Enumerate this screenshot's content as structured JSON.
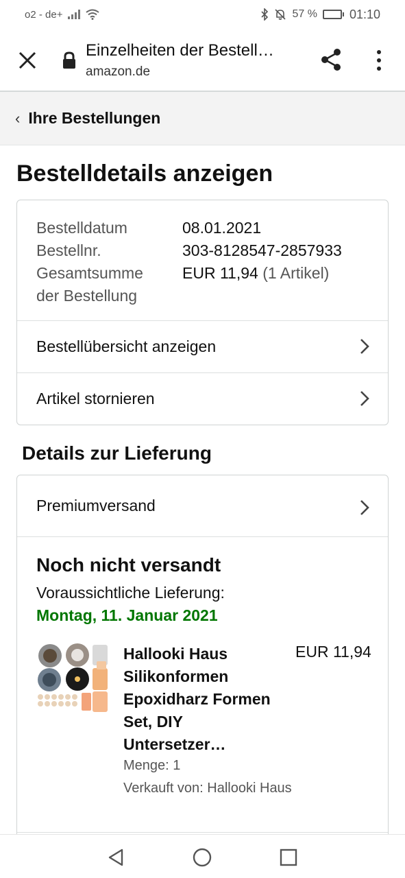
{
  "status_bar": {
    "carrier": "o2 - de+",
    "battery_text": "57 %",
    "battery_level": 0.57,
    "time": "01:10",
    "icons": [
      "signal-icon",
      "wifi-icon",
      "bluetooth-icon",
      "mute-icon",
      "battery-icon"
    ]
  },
  "browser": {
    "title": "Einzelheiten der Bestell…",
    "url": "amazon.de",
    "icons": [
      "close-icon",
      "lock-icon",
      "share-icon",
      "more-vert-icon"
    ]
  },
  "breadcrumb": {
    "label": "Ihre Bestellungen"
  },
  "page": {
    "title": "Bestelldetails anzeigen"
  },
  "order": {
    "date_label": "Bestelldatum",
    "date_value": "08.01.2021",
    "number_label": "Bestellnr.",
    "number_value": "303-8128547-2857933",
    "total_label_line1": "Gesamtsumme",
    "total_label_line2": "der Bestellung",
    "total_value": "EUR 11,94",
    "total_items": "(1 Artikel)",
    "summary_link": "Bestellübersicht anzeigen",
    "cancel_link": "Artikel stornieren"
  },
  "delivery": {
    "section_title": "Details zur Lieferung",
    "shipping_method": "Premiumversand",
    "status": "Noch nicht versandt",
    "eta_label": "Voraussichtliche Lieferung:",
    "eta_date": "Montag, 11. Januar 2021",
    "eta_color": "#007600"
  },
  "product": {
    "name": "Hallooki Haus Silikonformen Epoxidharz Formen Set, DIY Untersetzer…",
    "price": "EUR 11,94",
    "quantity": "Menge: 1",
    "seller": "Verkauft von: Hallooki Haus"
  },
  "nav_bar": {
    "icons": [
      "back-triangle-icon",
      "home-circle-icon",
      "recents-square-icon"
    ]
  }
}
